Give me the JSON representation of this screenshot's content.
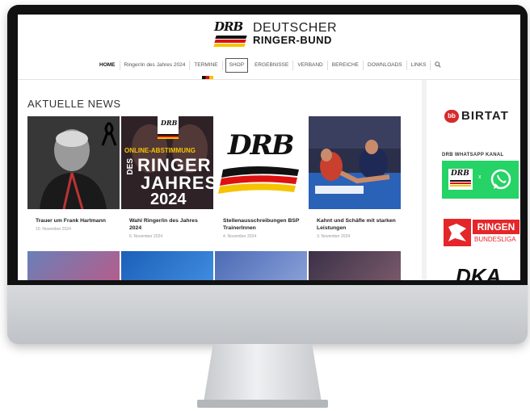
{
  "logo": {
    "mark_text": "DRB",
    "line1": "DEUTSCHER",
    "line2": "RINGER-BUND"
  },
  "nav": {
    "items": [
      "HOME",
      "Ringer/in des Jahres 2024",
      "TERMINE",
      "SHOP",
      "ERGEBNISSE",
      "VERBAND",
      "BEREICHE",
      "DOWNLOADS",
      "LINKS"
    ],
    "search_icon": "magnifier"
  },
  "news": {
    "section_title": "AKTUELLE NEWS",
    "cards": [
      {
        "title": "Trauer um Frank Hartmann",
        "date": "10. November 2024"
      },
      {
        "title": "Wahl Ringer/in des Jahres 2024",
        "date": "6. November 2024",
        "thumb_lines": [
          "ONLINE-ABSTIMMUNG",
          "DES",
          "RINGER",
          "JAHRES",
          "2024"
        ],
        "thumb_badge": "DRB"
      },
      {
        "title": "Stellenausschreibungen BSP TrainerInnen",
        "date": "4. November 2024",
        "thumb_logo": "DRB"
      },
      {
        "title": "Kahnt und Schäfle mit starken Leistungen",
        "date": "3. November 2024"
      }
    ]
  },
  "sidebar": {
    "birtat": {
      "mark": "bb",
      "name": "BIRTAT"
    },
    "whatsapp": {
      "label": "DRB WHATSAPP KANAL",
      "logo": "DRB",
      "separator": "x"
    },
    "ringen": {
      "title": "RINGEN",
      "subtitle": "BUNDESLIGA"
    },
    "dka": "DKA"
  },
  "colors": {
    "accent_red": "#e4262a",
    "whatsapp_green": "#25d366",
    "german_black": "#111111",
    "german_red": "#dd1111",
    "german_gold": "#f5c400"
  }
}
